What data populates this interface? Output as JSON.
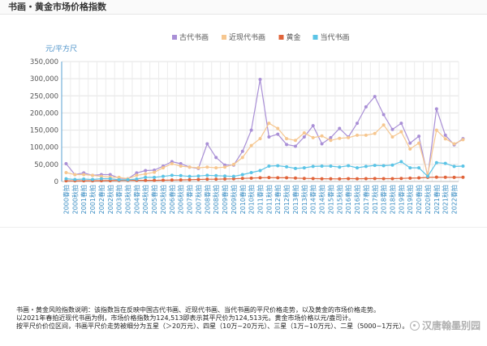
{
  "page": {
    "title": "书画・黄金市场价格指数",
    "notes": [
      "书画・黄金风险指数说明：该指数旨在反映中国古代书画、近现代书画、当代书画的平尺价格走势，以及黄金的市场价格走势。",
      "以2021年春拍近现代书画为例，市场价格指数为124,513即表示其平尺价为124,513元。黄金市场价格以元/盎司计。",
      "按平尺价价位区间，书画平尺价走势被细分为五星（＞20万元）、四星（10万~20万元）、三星（1万~10万元）、二星（5000~1万元）。"
    ],
    "watermark": "汉唐翰墨别园"
  },
  "chart_data": {
    "type": "line",
    "title": "",
    "ylabel": "元/平方尺",
    "xlabel": "",
    "ylim": [
      0,
      350000
    ],
    "yticks": [
      0,
      50000,
      100000,
      150000,
      200000,
      250000,
      300000,
      350000
    ],
    "ytick_labels": [
      "0",
      "50,000",
      "100,000",
      "150,000",
      "200,000",
      "250,000",
      "300,000",
      "350,000"
    ],
    "grid": true,
    "legend_position": "top",
    "categories": [
      "2000春拍",
      "2000秋拍",
      "2001春拍",
      "2001秋拍",
      "2002春拍",
      "2002秋拍",
      "2003春拍",
      "2003秋拍",
      "2004春拍",
      "2004秋拍",
      "2005春拍",
      "2005秋拍",
      "2006春拍",
      "2006秋拍",
      "2007春拍",
      "2007秋拍",
      "2008春拍",
      "2008秋拍",
      "2009春拍",
      "2009秋拍",
      "2010春拍",
      "2010秋拍",
      "2011春拍",
      "2011秋拍",
      "2012春拍",
      "2012秋拍",
      "2013春拍",
      "2013秋拍",
      "2014春拍",
      "2014秋拍",
      "2015春拍",
      "2015秋拍",
      "2016春拍",
      "2016秋拍",
      "2017春拍",
      "2017秋拍",
      "2018春拍",
      "2018秋拍",
      "2019春拍",
      "2019秋拍",
      "2020春拍",
      "2020秋拍",
      "2021春拍",
      "2021秋拍",
      "2022春拍"
    ],
    "series": [
      {
        "name": "古代书画",
        "color": "#a98fd6",
        "values": [
          52000,
          20000,
          25000,
          18000,
          20000,
          20000,
          10000,
          8000,
          25000,
          32000,
          33000,
          45000,
          58000,
          52000,
          42000,
          38000,
          110000,
          70000,
          48000,
          48000,
          88000,
          150000,
          298000,
          130000,
          138000,
          108000,
          103000,
          130000,
          163000,
          110000,
          128000,
          155000,
          130000,
          170000,
          218000,
          248000,
          195000,
          152000,
          170000,
          112000,
          132000,
          15000,
          212000,
          135000,
          107000,
          125000
        ]
      },
      {
        "name": "近现代书画",
        "color": "#f6c790",
        "values": [
          26000,
          20000,
          20000,
          18000,
          15000,
          13000,
          12000,
          8000,
          18000,
          22000,
          27000,
          40000,
          52000,
          45000,
          42000,
          40000,
          42000,
          40000,
          42000,
          50000,
          70000,
          105000,
          125000,
          170000,
          155000,
          125000,
          120000,
          142000,
          128000,
          133000,
          120000,
          126000,
          128000,
          135000,
          135000,
          140000,
          165000,
          130000,
          145000,
          95000,
          112000,
          20000,
          150000,
          124513,
          110000,
          122000
        ]
      },
      {
        "name": "黄金",
        "color": "#e0643a",
        "values": [
          2000,
          2000,
          2100,
          2200,
          2300,
          2500,
          2800,
          3000,
          3200,
          3300,
          3400,
          3700,
          4300,
          4800,
          5300,
          5900,
          6700,
          6700,
          7400,
          7900,
          9100,
          9900,
          10800,
          11400,
          10800,
          11000,
          10000,
          9000,
          8500,
          8100,
          7900,
          7600,
          8400,
          8000,
          8300,
          8600,
          8300,
          8200,
          8900,
          9900,
          10500,
          12000,
          12600,
          12400,
          12000,
          12300
        ]
      },
      {
        "name": "当代书画",
        "color": "#5bc4e6",
        "values": [
          8000,
          6000,
          7000,
          6000,
          8000,
          8000,
          5000,
          5000,
          7000,
          12000,
          12000,
          15000,
          18000,
          17000,
          15000,
          16000,
          18000,
          17000,
          16000,
          15000,
          20000,
          26000,
          32000,
          45000,
          46000,
          43000,
          38000,
          40000,
          44000,
          45000,
          45000,
          42000,
          46000,
          40000,
          44000,
          47000,
          46000,
          48000,
          58000,
          40000,
          40000,
          15000,
          55000,
          53000,
          44000,
          45000
        ]
      }
    ]
  }
}
